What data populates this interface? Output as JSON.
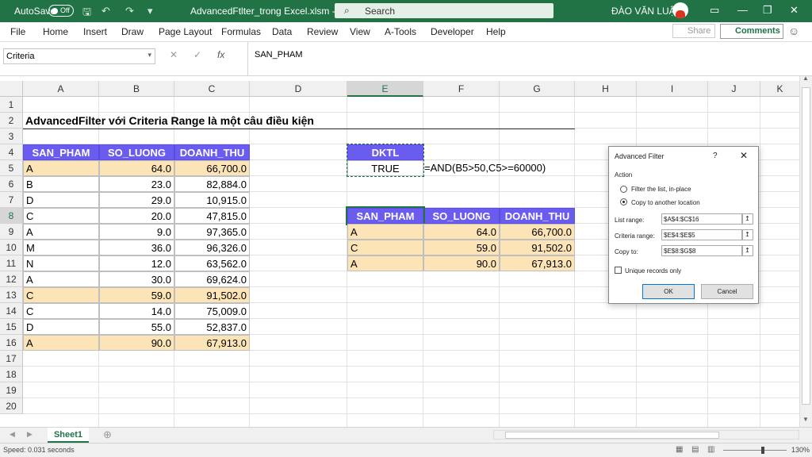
{
  "titlebar": {
    "autosave_label": "AutoSave",
    "autosave_state": "Off",
    "filename": "AdvancedFtlter_trong Excel.xlsm  -  Ex...",
    "search_placeholder": "Search",
    "user_name": "ĐÀO VĂN LUẬN",
    "bg_color": "#217346"
  },
  "menu": {
    "items": [
      "File",
      "Home",
      "Insert",
      "Draw",
      "Page Layout",
      "Formulas",
      "Data",
      "Review",
      "View",
      "A-Tools",
      "Developer",
      "Help"
    ],
    "share_label": "Share",
    "comments_label": "Comments"
  },
  "formula_bar": {
    "name_box": "Criteria",
    "formula": "SAN_PHAM",
    "fx_label": "fx"
  },
  "columns": [
    "A",
    "B",
    "C",
    "D",
    "E",
    "F",
    "G",
    "H",
    "I",
    "J",
    "K"
  ],
  "selected_column": "E",
  "selected_row": "8",
  "rows": [
    "1",
    "2",
    "3",
    "4",
    "5",
    "6",
    "7",
    "8",
    "9",
    "10",
    "11",
    "12",
    "13",
    "14",
    "15",
    "16",
    "17",
    "18",
    "19",
    "20"
  ],
  "sheet": {
    "title": "AdvancedFilter với Criteria Range là một câu điều kiện",
    "headers": [
      "SAN_PHAM",
      "SO_LUONG",
      "DOANH_THU"
    ],
    "data": [
      {
        "sp": "A",
        "sl": "64.0",
        "dt": "66,700.0",
        "hl": true
      },
      {
        "sp": "B",
        "sl": "23.0",
        "dt": "82,884.0",
        "hl": false
      },
      {
        "sp": "D",
        "sl": "29.0",
        "dt": "10,915.0",
        "hl": false
      },
      {
        "sp": "C",
        "sl": "20.0",
        "dt": "47,815.0",
        "hl": false
      },
      {
        "sp": "A",
        "sl": "9.0",
        "dt": "97,365.0",
        "hl": false
      },
      {
        "sp": "M",
        "sl": "36.0",
        "dt": "96,326.0",
        "hl": false
      },
      {
        "sp": "N",
        "sl": "12.0",
        "dt": "63,562.0",
        "hl": false
      },
      {
        "sp": "A",
        "sl": "30.0",
        "dt": "69,624.0",
        "hl": false
      },
      {
        "sp": "C",
        "sl": "59.0",
        "dt": "91,502.0",
        "hl": true
      },
      {
        "sp": "C",
        "sl": "14.0",
        "dt": "75,009.0",
        "hl": false
      },
      {
        "sp": "D",
        "sl": "55.0",
        "dt": "52,837.0",
        "hl": false
      },
      {
        "sp": "A",
        "sl": "90.0",
        "dt": "67,913.0",
        "hl": true
      }
    ],
    "criteria_header": "DKTL",
    "criteria_value": "TRUE",
    "criteria_formula": "=AND(B5>50,C5>=60000)",
    "result": [
      {
        "sp": "A",
        "sl": "64.0",
        "dt": "66,700.0"
      },
      {
        "sp": "C",
        "sl": "59.0",
        "dt": "91,502.0"
      },
      {
        "sp": "A",
        "sl": "90.0",
        "dt": "67,913.0"
      }
    ],
    "header_color": "#6b5cf0",
    "highlight_color": "#fce4b6"
  },
  "dialog": {
    "title": "Advanced Filter",
    "help": "?",
    "close": "✕",
    "action_label": "Action",
    "option_filter": "Filter the list, in-place",
    "option_copy": "Copy to another location",
    "list_range_label": "List range:",
    "list_range_value": "$A$4:$C$16",
    "criteria_range_label": "Criteria range:",
    "criteria_range_value": "$E$4:$E$5",
    "copy_to_label": "Copy to:",
    "copy_to_value": "$E$8:$G$8",
    "unique_label": "Unique records only",
    "ok_label": "OK",
    "cancel_label": "Cancel"
  },
  "tabs": {
    "sheet_name": "Sheet1"
  },
  "status": {
    "text": "Speed: 0.031 seconds",
    "zoom": "130%"
  }
}
